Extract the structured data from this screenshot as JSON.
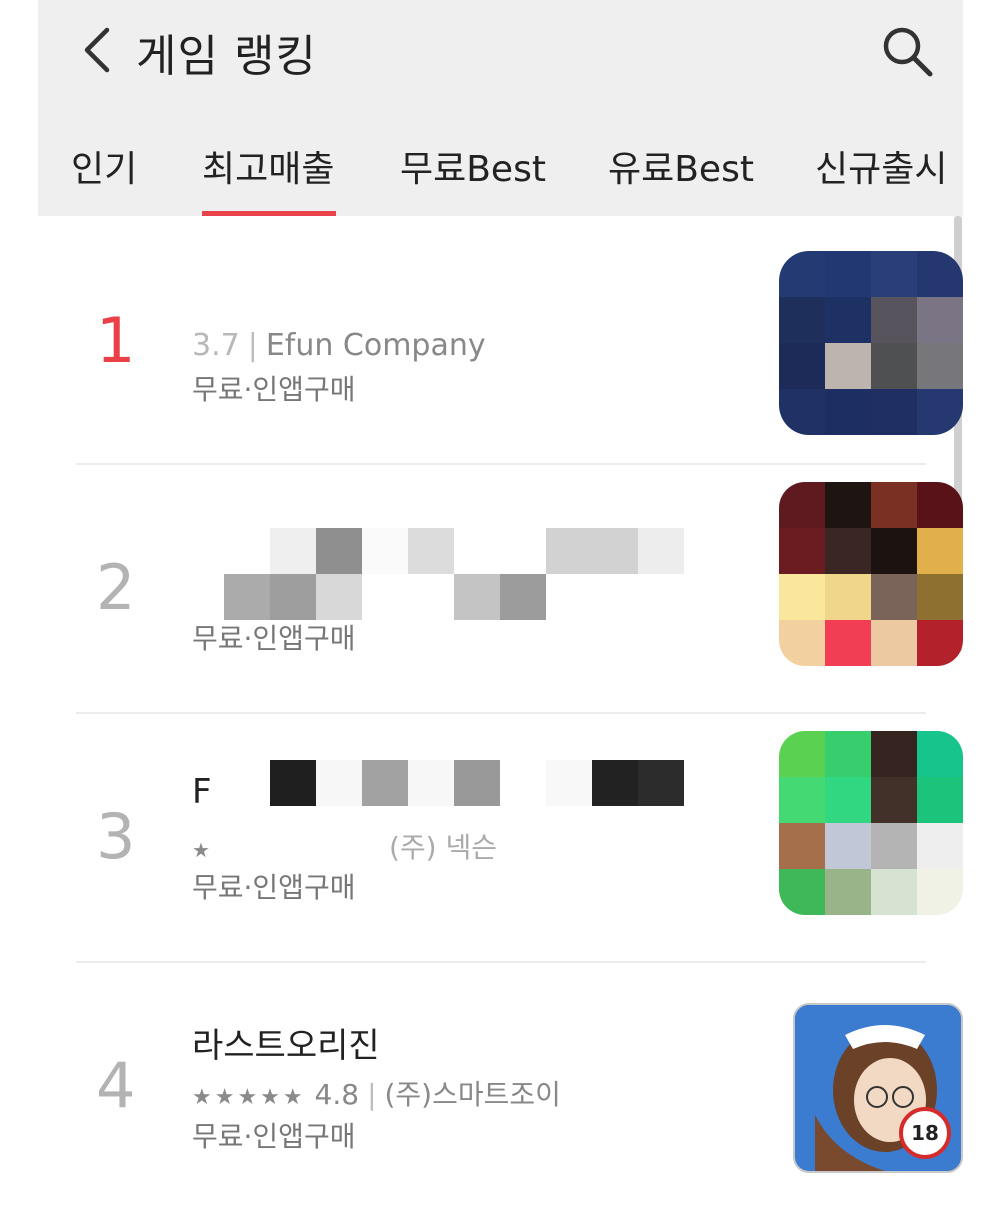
{
  "header": {
    "title": "게임 랭킹",
    "tabs": [
      {
        "label": "인기",
        "active": false
      },
      {
        "label": "최고매출",
        "active": true
      },
      {
        "label": "무료Best",
        "active": false
      },
      {
        "label": "유료Best",
        "active": false
      },
      {
        "label": "신규출시",
        "active": false
      }
    ]
  },
  "colors": {
    "accent": "#e8434a",
    "header_bg": "#efefef"
  },
  "rows": [
    {
      "rank": "1",
      "name": "",
      "rating": "3.7",
      "developer": "Efun Company",
      "price": "무료·인앱구매"
    },
    {
      "rank": "2",
      "name": "",
      "rating": "",
      "developer": "",
      "price": "무료·인앱구매"
    },
    {
      "rank": "3",
      "name": "F",
      "rating": "",
      "developer": "(주) 넥슨",
      "price": "무료·인앱구매"
    },
    {
      "rank": "4",
      "name": "라스트오리진",
      "stars": "★★★★★",
      "rating": "4.8",
      "developer": "(주)스마트조이",
      "price": "무료·인앱구매",
      "age_badge": "18"
    }
  ]
}
